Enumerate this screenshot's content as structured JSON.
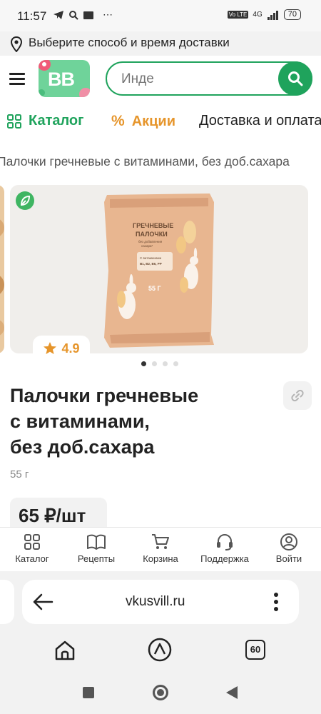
{
  "status_bar": {
    "time": "11:57",
    "battery": "70",
    "network": "4G"
  },
  "delivery": {
    "text": "Выберите способ и время доставки"
  },
  "header": {
    "logo_text": "BB",
    "search_placeholder": "Инде"
  },
  "nav": {
    "items": [
      {
        "label": "Каталог"
      },
      {
        "label": "Акции"
      },
      {
        "label": "Доставка и оплата"
      }
    ]
  },
  "breadcrumb": {
    "text": "Палочки гречневые с витаминами, без доб.сахара"
  },
  "product": {
    "rating": "4.9",
    "title_lines": [
      "Палочки гречневые",
      "с витаминами,",
      "без доб.сахара"
    ],
    "weight": "55 г",
    "price": "65 ₽/шт",
    "package_title_1": "ГРЕЧНЕВЫЕ",
    "package_title_2": "ПАЛОЧКИ",
    "package_sub_1": "без добавления",
    "package_sub_2": "сахара*",
    "package_weight": "55 Г",
    "package_vitamins_1": "С витаминами",
    "package_vitamins_2": "B1, B2, B6, PP"
  },
  "gallery": {
    "total": 4,
    "active": 1
  },
  "tabbar": {
    "items": [
      {
        "label": "Каталог"
      },
      {
        "label": "Рецепты"
      },
      {
        "label": "Корзина"
      },
      {
        "label": "Поддержка"
      },
      {
        "label": "Войти"
      }
    ]
  },
  "browser": {
    "url": "vkusvill.ru",
    "tabs_count": "60"
  },
  "colors": {
    "brand_green": "#1fa35c",
    "accent_orange": "#e6952b",
    "star": "#e6952b"
  }
}
